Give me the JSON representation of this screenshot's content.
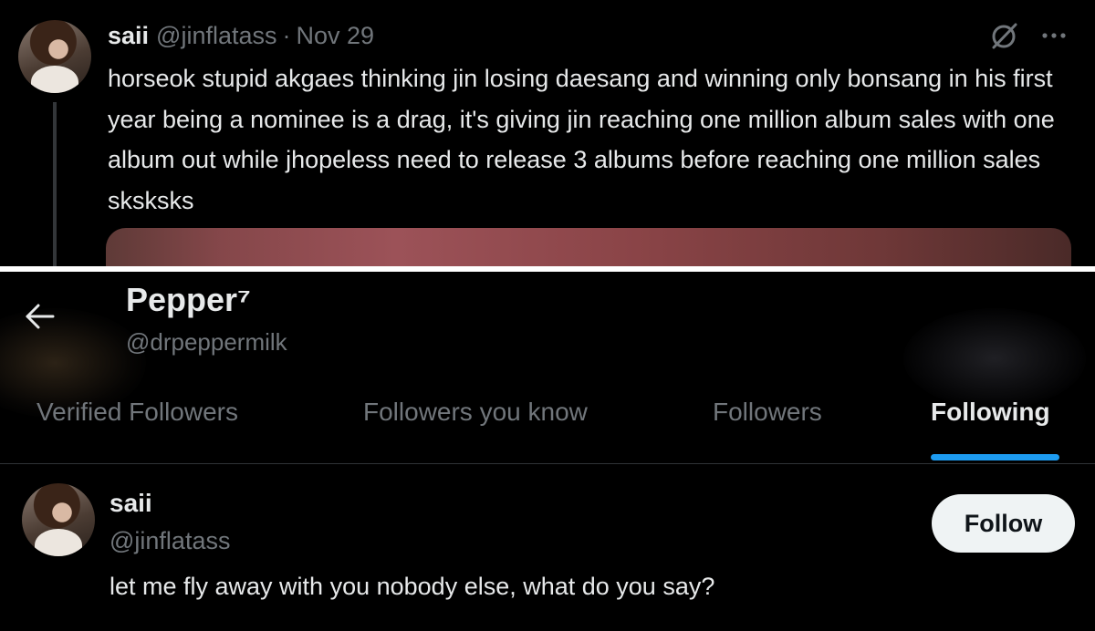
{
  "tweet": {
    "author_name": "saii",
    "author_handle": "@jinflatass",
    "separator": "·",
    "date": "Nov 29",
    "text": "horseok stupid akgaes thinking jin losing daesang and winning only bonsang in his first year being a nominee is a drag, it's giving jin reaching one million album sales with one album out while jhopeless need to release 3 albums before reaching one million sales sksksks",
    "icons": [
      "grok-icon",
      "more-icon"
    ]
  },
  "profile": {
    "name": "Pepper⁷",
    "handle": "@drpeppermilk"
  },
  "tabs": [
    {
      "label": "Verified Followers",
      "active": false
    },
    {
      "label": "Followers you know",
      "active": false
    },
    {
      "label": "Followers",
      "active": false
    },
    {
      "label": "Following",
      "active": true
    }
  ],
  "following_list": [
    {
      "name": "saii",
      "handle": "@jinflatass",
      "bio": "let me fly away with you nobody else, what do you say?",
      "button_label": "Follow"
    }
  ],
  "colors": {
    "background": "#000000",
    "text_primary": "#e7e9ea",
    "text_secondary": "#71767b",
    "accent": "#1d9bf0",
    "button_bg": "#eff3f4",
    "border": "#2f3336"
  }
}
